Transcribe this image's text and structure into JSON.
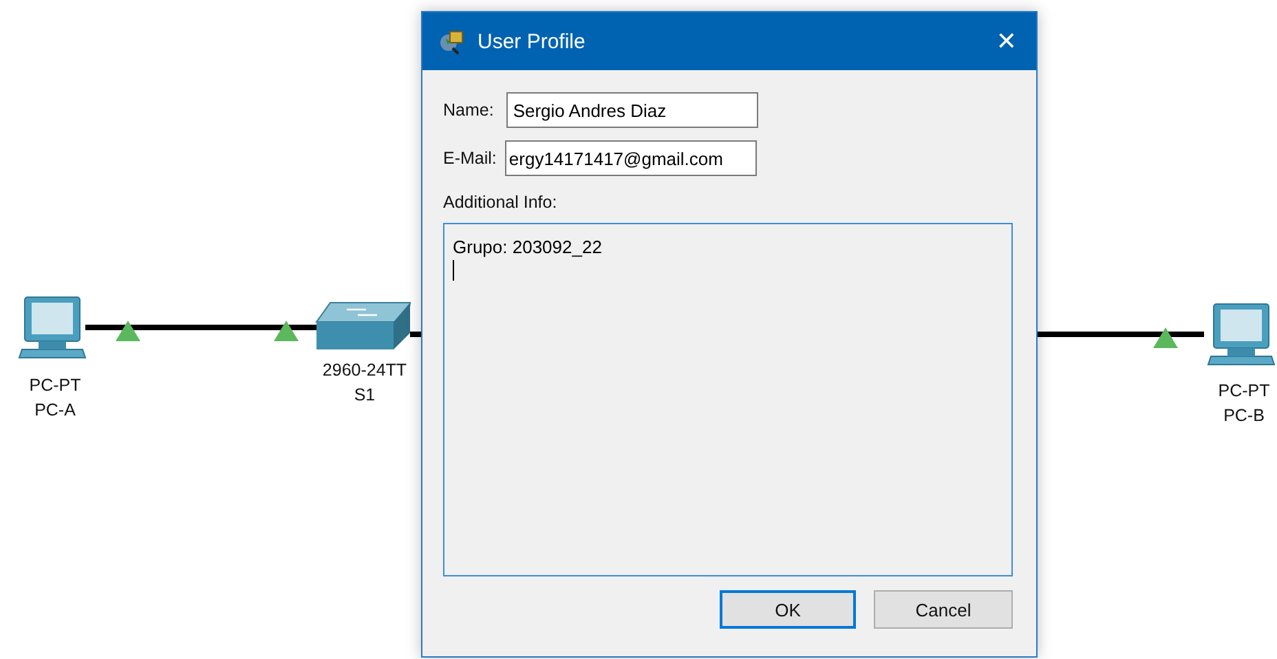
{
  "topology": {
    "nodes": [
      {
        "kind": "pc",
        "model": "PC-PT",
        "name": "PC-A"
      },
      {
        "kind": "switch",
        "model": "2960-24TT",
        "name": "S1"
      },
      {
        "kind": "pc",
        "model": "PC-PT",
        "name": "PC-B"
      }
    ],
    "links": [
      {
        "lights": [
          {
            "up": true
          },
          {
            "up": true
          }
        ]
      },
      {
        "lights": [
          {
            "up": true
          }
        ]
      }
    ]
  },
  "dialog": {
    "title": "User Profile",
    "close": "✕",
    "fields": [
      {
        "label": "Name:",
        "value": "Sergio Andres Diaz"
      },
      {
        "label": "E-Mail:",
        "value": "ergy14171417@gmail.com"
      }
    ],
    "info_label": "Additional Info:",
    "info_value": "Grupo: 203092_22\n",
    "info_focused": true,
    "buttons": [
      {
        "label": "OK",
        "default": true
      },
      {
        "label": "Cancel",
        "default": false
      }
    ]
  }
}
